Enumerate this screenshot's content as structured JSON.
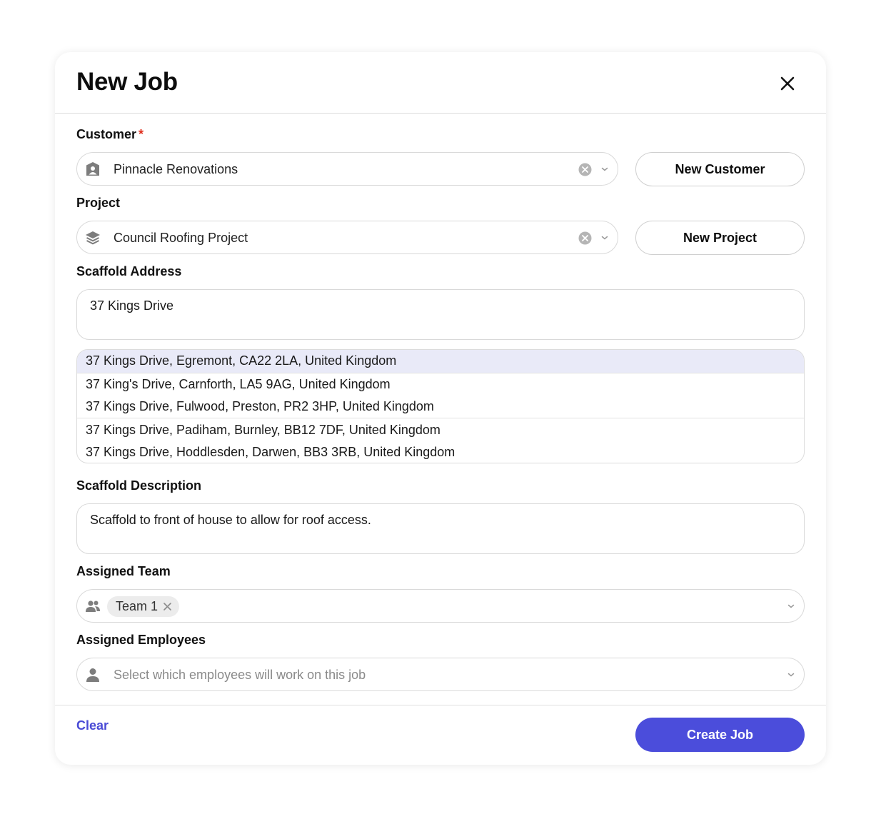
{
  "modal": {
    "title": "New Job",
    "close_icon": "close-icon"
  },
  "customer": {
    "label": "Customer",
    "required_mark": "*",
    "value": "Pinnacle Renovations",
    "icon": "customer-icon",
    "new_button": "New Customer"
  },
  "project": {
    "label": "Project",
    "value": "Council Roofing Project",
    "icon": "layers-icon",
    "new_button": "New Project"
  },
  "address": {
    "label": "Scaffold Address",
    "value": "37 Kings Drive",
    "suggestions": [
      "37 Kings Drive, Egremont, CA22 2LA, United Kingdom",
      "37 King's Drive, Carnforth, LA5 9AG, United Kingdom",
      "37 Kings Drive, Fulwood, Preston, PR2 3HP, United Kingdom",
      "37 Kings Drive, Padiham, Burnley, BB12 7DF, United Kingdom",
      "37 Kings Drive, Hoddlesden, Darwen, BB3 3RB, United Kingdom"
    ]
  },
  "description": {
    "label": "Scaffold Description",
    "value": "Scaffold to front of house to allow for roof access."
  },
  "team": {
    "label": "Assigned Team",
    "icon": "team-icon",
    "chips": [
      "Team 1"
    ]
  },
  "employees": {
    "label": "Assigned Employees",
    "icon": "person-icon",
    "placeholder": "Select which employees will work on this job"
  },
  "footer": {
    "clear": "Clear",
    "submit": "Create Job"
  },
  "colors": {
    "accent": "#4b4ddb",
    "required": "#e0301e",
    "highlight": "#e9eaf8"
  }
}
